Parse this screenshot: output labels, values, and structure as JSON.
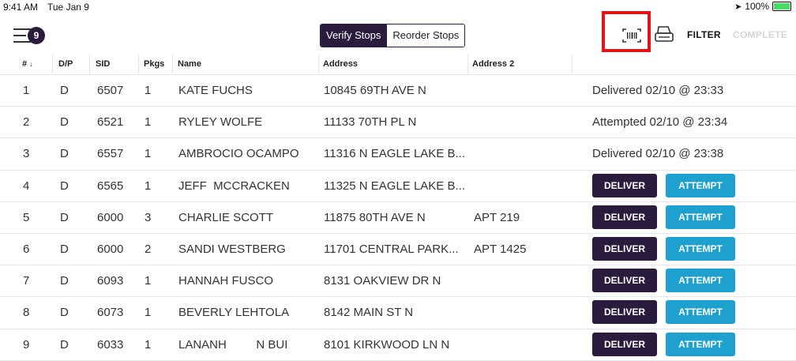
{
  "status_bar": {
    "time": "9:41 AM",
    "date": "Tue Jan 9",
    "battery": "100%"
  },
  "toolbar": {
    "badge_count": "9",
    "segment_verify": "Verify Stops",
    "segment_reorder": "Reorder Stops",
    "filter_label": "FILTER",
    "complete_label": "COMPLETE"
  },
  "columns": {
    "num": "#",
    "num_sort": "↓",
    "dp": "D/P",
    "sid": "SID",
    "pkgs": "Pkgs",
    "name": "Name",
    "address": "Address",
    "address2": "Address 2"
  },
  "actions": {
    "deliver": "DELIVER",
    "attempt": "ATTEMPT"
  },
  "rows": [
    {
      "num": "1",
      "dp": "D",
      "sid": "6507",
      "pkgs": "1",
      "name": "KATE FUCHS",
      "address": "10845 69TH AVE N",
      "address2": "",
      "status": "Delivered 02/10 @ 23:33"
    },
    {
      "num": "2",
      "dp": "D",
      "sid": "6521",
      "pkgs": "1",
      "name": "RYLEY WOLFE",
      "address": "11133 70TH PL N",
      "address2": "",
      "status": "Attempted 02/10 @ 23:34"
    },
    {
      "num": "3",
      "dp": "D",
      "sid": "6557",
      "pkgs": "1",
      "name": "AMBROCIO OCAMPO",
      "address": "11316 N EAGLE LAKE B...",
      "address2": "",
      "status": "Delivered 02/10 @ 23:38"
    },
    {
      "num": "4",
      "dp": "D",
      "sid": "6565",
      "pkgs": "1",
      "name": "JEFF  MCCRACKEN",
      "address": "11325 N EAGLE LAKE B...",
      "address2": "",
      "status": ""
    },
    {
      "num": "5",
      "dp": "D",
      "sid": "6000",
      "pkgs": "3",
      "name": "CHARLIE SCOTT",
      "address": "11875 80TH AVE N",
      "address2": "APT 219",
      "status": ""
    },
    {
      "num": "6",
      "dp": "D",
      "sid": "6000",
      "pkgs": "2",
      "name": "SANDI WESTBERG",
      "address": "11701 CENTRAL PARK...",
      "address2": "APT 1425",
      "status": ""
    },
    {
      "num": "7",
      "dp": "D",
      "sid": "6093",
      "pkgs": "1",
      "name": "HANNAH FUSCO",
      "address": "8131 OAKVIEW DR N",
      "address2": "",
      "status": ""
    },
    {
      "num": "8",
      "dp": "D",
      "sid": "6073",
      "pkgs": "1",
      "name": "BEVERLY LEHTOLA",
      "address": "8142 MAIN ST N",
      "address2": "",
      "status": ""
    },
    {
      "num": "9",
      "dp": "D",
      "sid": "6033",
      "pkgs": "1",
      "name": "LANANH         N BUI",
      "address": "8101 KIRKWOOD LN N",
      "address2": "",
      "status": ""
    }
  ]
}
